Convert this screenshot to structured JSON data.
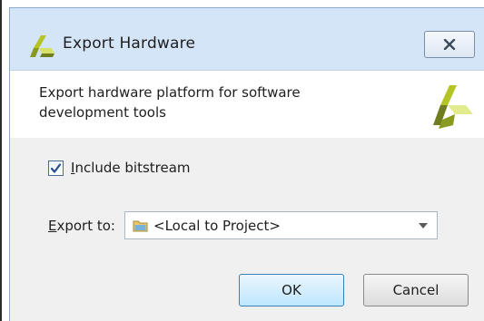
{
  "window": {
    "title": "Export Hardware",
    "close_label": "X"
  },
  "header": {
    "description": "Export hardware platform for software development tools"
  },
  "options": {
    "include_bitstream": {
      "mnemonic": "I",
      "rest": "nclude bitstream",
      "checked": true
    },
    "export_to": {
      "mnemonic": "E",
      "rest": "xport to:",
      "value": "<Local to Project>"
    }
  },
  "buttons": {
    "ok_label": "OK",
    "cancel_label": "Cancel"
  },
  "icons": {
    "app": "vivado-logo-icon",
    "folder": "folder-icon",
    "close": "close-icon"
  },
  "colors": {
    "titlebar": "#d4e5f7",
    "logo_dark": "#6f7d1e",
    "logo_mid": "#b5c425",
    "logo_light": "#e3eb8f"
  }
}
